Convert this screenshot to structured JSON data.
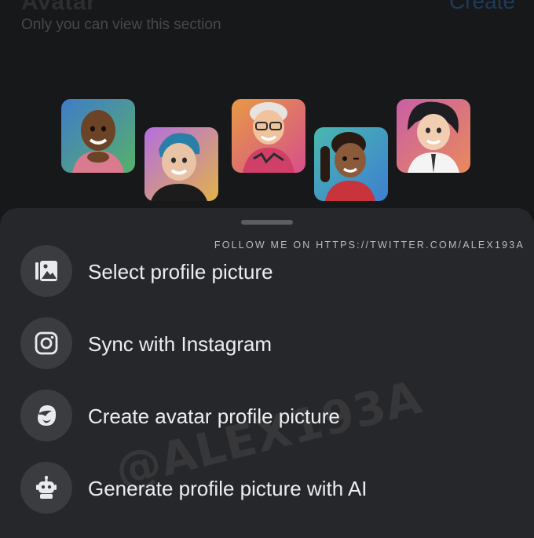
{
  "header": {
    "title": "Avatar",
    "create_label": "Create",
    "subtitle": "Only you can view this section"
  },
  "colors": {
    "sheet": "#26272a",
    "icon_circle": "#3b3c40",
    "background": "#161718"
  },
  "avatars": [
    {
      "name": "avatar-1",
      "skin": "#6b4327",
      "bg1": "#3f7cc9",
      "bg2": "#58b06a"
    },
    {
      "name": "avatar-2",
      "skin": "#e9c3a5",
      "bg1": "#b46ee0",
      "bg2": "#e2b24a"
    },
    {
      "name": "avatar-3",
      "skin": "#f0c39e",
      "bg1": "#e79a45",
      "bg2": "#d64f8c"
    },
    {
      "name": "avatar-4",
      "skin": "#8a5a3a",
      "bg1": "#49b8b0",
      "bg2": "#3d7fd1"
    },
    {
      "name": "avatar-5",
      "skin": "#f1cdb2",
      "bg1": "#c95fa6",
      "bg2": "#e98a5b"
    }
  ],
  "sheet": {
    "watermark_link": "FOLLOW ME ON HTTPS://TWITTER.COM/ALEX193A",
    "watermark_tag": "@ALEX193A",
    "options": [
      {
        "label": "Select profile picture",
        "icon": "photo-gallery-icon"
      },
      {
        "label": "Sync with Instagram",
        "icon": "instagram-icon"
      },
      {
        "label": "Create avatar profile picture",
        "icon": "avatar-face-icon"
      },
      {
        "label": "Generate profile picture with AI",
        "icon": "robot-icon"
      }
    ]
  }
}
